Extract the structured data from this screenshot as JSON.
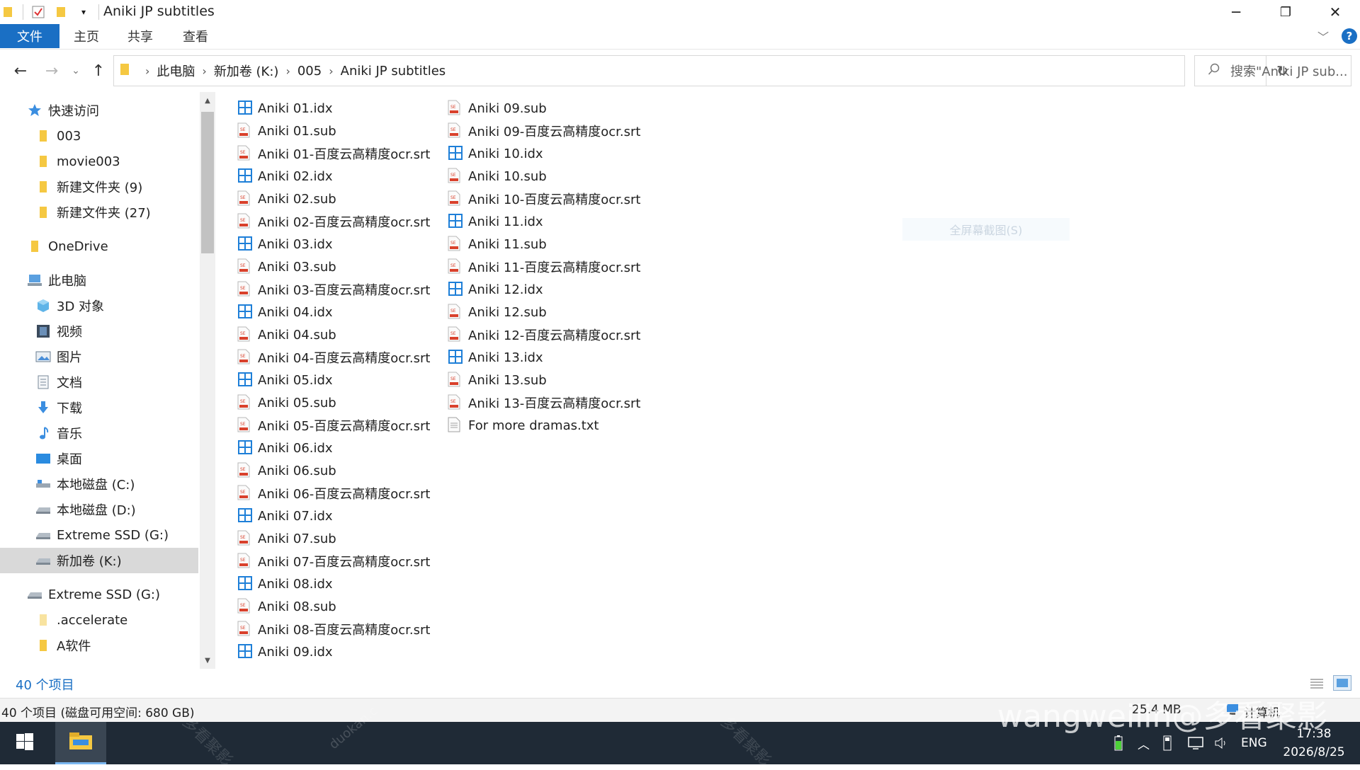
{
  "window": {
    "title": "Aniki JP subtitles",
    "minimize": "─",
    "restore": "❐",
    "close": "✕"
  },
  "ribbon": {
    "tabs": [
      "文件",
      "主页",
      "共享",
      "查看"
    ],
    "expand_icon": "﹀",
    "help_icon": "?"
  },
  "address": {
    "crumbs": [
      "此电脑",
      "新加卷 (K:)",
      "005",
      "Aniki JP subtitles"
    ],
    "search_placeholder": "搜索\"Aniki JP sub...",
    "back": "←",
    "forward": "→",
    "recent": "⌄",
    "up": "↑",
    "dropdown": "⌄",
    "refresh": "↻"
  },
  "navpane": {
    "items": [
      {
        "label": "快速访问",
        "icon": "star-icon",
        "indent": 0
      },
      {
        "label": "003",
        "icon": "folder-icon",
        "indent": 1
      },
      {
        "label": "movie003",
        "icon": "folder-icon",
        "indent": 1
      },
      {
        "label": "新建文件夹 (9)",
        "icon": "folder-icon",
        "indent": 1
      },
      {
        "label": "新建文件夹 (27)",
        "icon": "folder-icon",
        "indent": 1
      },
      {
        "label": "OneDrive",
        "icon": "folder-icon",
        "indent": 0
      },
      {
        "label": "此电脑",
        "icon": "pc-icon",
        "indent": 0
      },
      {
        "label": "3D 对象",
        "icon": "cube-icon",
        "indent": 1
      },
      {
        "label": "视频",
        "icon": "video-icon",
        "indent": 1
      },
      {
        "label": "图片",
        "icon": "picture-icon",
        "indent": 1
      },
      {
        "label": "文档",
        "icon": "document-icon",
        "indent": 1
      },
      {
        "label": "下载",
        "icon": "download-icon",
        "indent": 1
      },
      {
        "label": "音乐",
        "icon": "music-icon",
        "indent": 1
      },
      {
        "label": "桌面",
        "icon": "desktop-icon",
        "indent": 1
      },
      {
        "label": "本地磁盘 (C:)",
        "icon": "drive-icon",
        "indent": 1
      },
      {
        "label": "本地磁盘 (D:)",
        "icon": "drive-icon",
        "indent": 1
      },
      {
        "label": "Extreme SSD (G:)",
        "icon": "drive-icon",
        "indent": 1
      },
      {
        "label": "新加卷 (K:)",
        "icon": "drive-icon",
        "indent": 1,
        "selected": true
      },
      {
        "label": "Extreme SSD (G:)",
        "icon": "drive-icon",
        "indent": 0
      },
      {
        "label": ".accelerate",
        "icon": "folder-light-icon",
        "indent": 1
      },
      {
        "label": "A软件",
        "icon": "folder-icon",
        "indent": 1
      }
    ],
    "scroll_up": "▲",
    "scroll_down": "▼"
  },
  "files": {
    "column1": [
      {
        "name": "Aniki 01.idx",
        "type": "idx"
      },
      {
        "name": "Aniki 01.sub",
        "type": "sub"
      },
      {
        "name": "Aniki 01-百度云高精度ocr.srt",
        "type": "srt"
      },
      {
        "name": "Aniki 02.idx",
        "type": "idx"
      },
      {
        "name": "Aniki 02.sub",
        "type": "sub"
      },
      {
        "name": "Aniki 02-百度云高精度ocr.srt",
        "type": "srt"
      },
      {
        "name": "Aniki 03.idx",
        "type": "idx"
      },
      {
        "name": "Aniki 03.sub",
        "type": "sub"
      },
      {
        "name": "Aniki 03-百度云高精度ocr.srt",
        "type": "srt"
      },
      {
        "name": "Aniki 04.idx",
        "type": "idx"
      },
      {
        "name": "Aniki 04.sub",
        "type": "sub"
      },
      {
        "name": "Aniki 04-百度云高精度ocr.srt",
        "type": "srt"
      },
      {
        "name": "Aniki 05.idx",
        "type": "idx"
      },
      {
        "name": "Aniki 05.sub",
        "type": "sub"
      },
      {
        "name": "Aniki 05-百度云高精度ocr.srt",
        "type": "srt"
      },
      {
        "name": "Aniki 06.idx",
        "type": "idx"
      },
      {
        "name": "Aniki 06.sub",
        "type": "sub"
      },
      {
        "name": "Aniki 06-百度云高精度ocr.srt",
        "type": "srt"
      },
      {
        "name": "Aniki 07.idx",
        "type": "idx"
      },
      {
        "name": "Aniki 07.sub",
        "type": "sub"
      },
      {
        "name": "Aniki 07-百度云高精度ocr.srt",
        "type": "srt"
      },
      {
        "name": "Aniki 08.idx",
        "type": "idx"
      },
      {
        "name": "Aniki 08.sub",
        "type": "sub"
      },
      {
        "name": "Aniki 08-百度云高精度ocr.srt",
        "type": "srt"
      },
      {
        "name": "Aniki 09.idx",
        "type": "idx"
      }
    ],
    "column2": [
      {
        "name": "Aniki 09.sub",
        "type": "sub"
      },
      {
        "name": "Aniki 09-百度云高精度ocr.srt",
        "type": "srt"
      },
      {
        "name": "Aniki 10.idx",
        "type": "idx"
      },
      {
        "name": "Aniki 10.sub",
        "type": "sub"
      },
      {
        "name": "Aniki 10-百度云高精度ocr.srt",
        "type": "srt"
      },
      {
        "name": "Aniki 11.idx",
        "type": "idx"
      },
      {
        "name": "Aniki 11.sub",
        "type": "sub"
      },
      {
        "name": "Aniki 11-百度云高精度ocr.srt",
        "type": "srt"
      },
      {
        "name": "Aniki 12.idx",
        "type": "idx"
      },
      {
        "name": "Aniki 12.sub",
        "type": "sub"
      },
      {
        "name": "Aniki 12-百度云高精度ocr.srt",
        "type": "srt"
      },
      {
        "name": "Aniki 13.idx",
        "type": "idx"
      },
      {
        "name": "Aniki 13.sub",
        "type": "sub"
      },
      {
        "name": "Aniki 13-百度云高精度ocr.srt",
        "type": "srt"
      },
      {
        "name": "For more dramas.txt",
        "type": "txt"
      }
    ]
  },
  "status": {
    "item_count": "40 个项目",
    "detail": "40 个项目 (磁盘可用空间: 680 GB)",
    "size": "25.4 MB",
    "computer_label": "计算机",
    "overlay_hint": "全屏幕截图(S)"
  },
  "taskbar": {
    "lang": "ENG",
    "time": "17:38",
    "date": "2026/8/25",
    "tray_up": "︿"
  },
  "watermark": {
    "text": "wangweilin@多看聚影",
    "site": "duokan.c",
    "cn": "多看聚影"
  },
  "colors": {
    "accent": "#1a6fc4",
    "selection": "#d9d9d9",
    "taskbar": "#1f2a36",
    "folder": "#f5c842",
    "idx_blue": "#1e7fd8",
    "srt_red": "#d9412c"
  }
}
